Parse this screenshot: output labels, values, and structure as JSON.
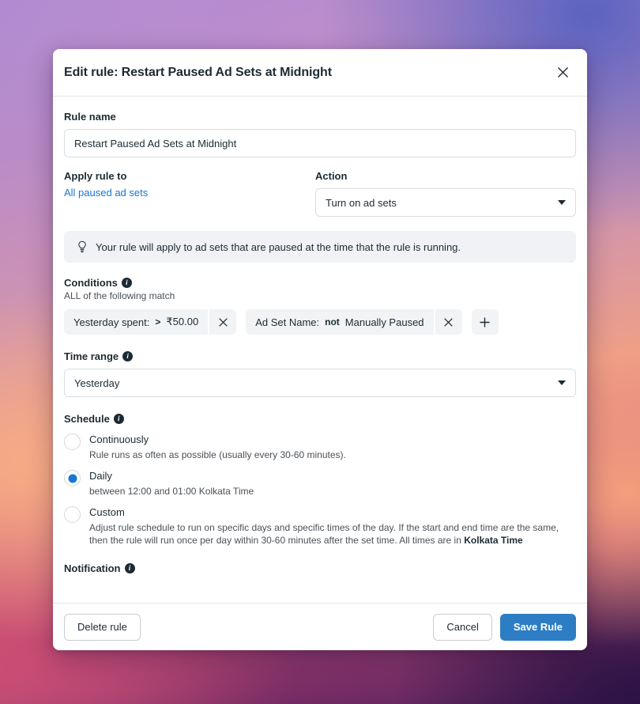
{
  "dialog": {
    "title": "Edit rule: Restart Paused Ad Sets at Midnight",
    "close_icon": "close-icon"
  },
  "rule_name": {
    "label": "Rule name",
    "value": "Restart Paused Ad Sets at Midnight",
    "placeholder": "Rule name"
  },
  "apply_rule_to": {
    "label": "Apply rule to",
    "link": "All paused ad sets"
  },
  "action": {
    "label": "Action",
    "value": "Turn on ad sets"
  },
  "tip": {
    "icon": "lightbulb-icon",
    "text": "Your rule will apply to ad sets that are paused at the time that the rule is running."
  },
  "conditions": {
    "label": "Conditions",
    "subtitle": "ALL of the following match",
    "items": [
      {
        "field": "Yesterday spent:",
        "operator": ">",
        "value": "₹50.00"
      },
      {
        "field": "Ad Set Name:",
        "operator": "not",
        "value": "Manually Paused"
      }
    ],
    "remove_icon": "close-icon",
    "add_label": "+"
  },
  "time_range": {
    "label": "Time range",
    "value": "Yesterday"
  },
  "schedule": {
    "label": "Schedule",
    "options": [
      {
        "title": "Continuously",
        "desc": "Rule runs as often as possible (usually every 30-60 minutes).",
        "selected": false
      },
      {
        "title": "Daily",
        "desc": "between 12:00 and 01:00 Kolkata Time",
        "selected": true
      },
      {
        "title": "Custom",
        "desc_pre": "Adjust rule schedule to run on specific days and specific times of the day. If the start and end time are the same, then the rule will run once per day within 30-60 minutes after the set time. All times are in ",
        "desc_bold": "Kolkata Time",
        "selected": false
      }
    ]
  },
  "notification": {
    "label": "Notification"
  },
  "footer": {
    "delete_label": "Delete rule",
    "cancel_label": "Cancel",
    "save_label": "Save Rule"
  },
  "colors": {
    "accent_blue": "#2d7dc4",
    "link_blue": "#1877d2",
    "text_dark": "#1c2b33",
    "pill_bg": "#f2f3f5",
    "tip_bg": "#f0f2f5"
  }
}
